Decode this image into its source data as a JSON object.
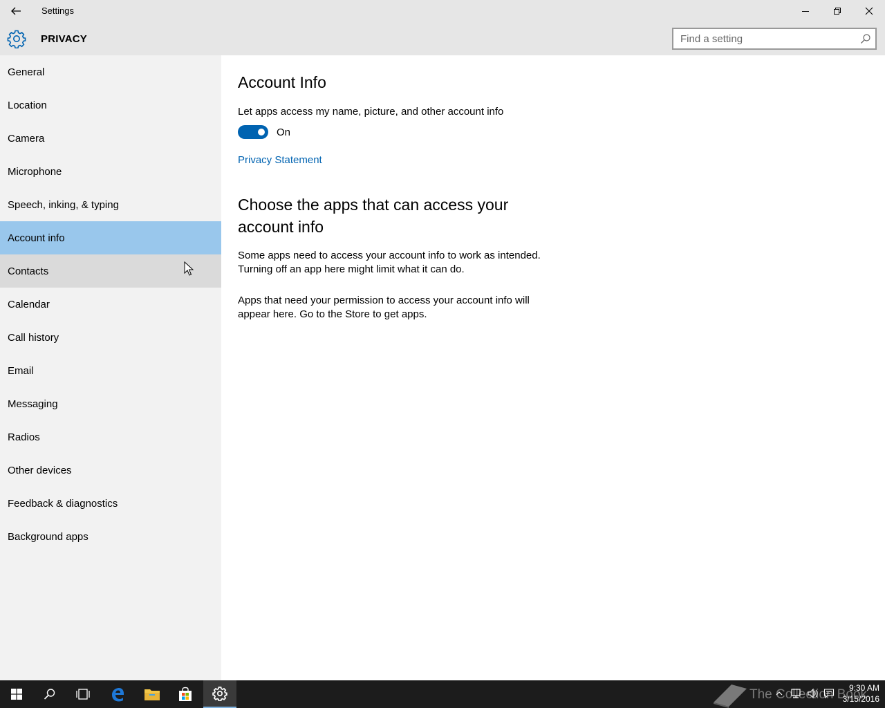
{
  "window": {
    "title": "Settings"
  },
  "header": {
    "title": "PRIVACY",
    "search_placeholder": "Find a setting"
  },
  "sidebar": {
    "items": [
      {
        "label": "General",
        "state": "normal"
      },
      {
        "label": "Location",
        "state": "normal"
      },
      {
        "label": "Camera",
        "state": "normal"
      },
      {
        "label": "Microphone",
        "state": "normal"
      },
      {
        "label": "Speech, inking, & typing",
        "state": "normal"
      },
      {
        "label": "Account info",
        "state": "selected"
      },
      {
        "label": "Contacts",
        "state": "hover"
      },
      {
        "label": "Calendar",
        "state": "normal"
      },
      {
        "label": "Call history",
        "state": "normal"
      },
      {
        "label": "Email",
        "state": "normal"
      },
      {
        "label": "Messaging",
        "state": "normal"
      },
      {
        "label": "Radios",
        "state": "normal"
      },
      {
        "label": "Other devices",
        "state": "normal"
      },
      {
        "label": "Feedback & diagnostics",
        "state": "normal"
      },
      {
        "label": "Background apps",
        "state": "normal"
      }
    ]
  },
  "main": {
    "heading": "Account Info",
    "toggle_label": "Let apps access my name, picture, and other account info",
    "toggle_on": true,
    "toggle_state_text": "On",
    "privacy_link": "Privacy Statement",
    "section_heading": "Choose the apps that can access your account info",
    "paragraph1": "Some apps need to access your account info to work as intended. Turning off an app here might limit what it can do.",
    "paragraph2": "Apps that need your permission to access your account info will appear here. Go to the Store to get apps."
  },
  "taskbar": {
    "watermark_text": "The Collection Book",
    "time": "9:30 AM",
    "date": "3/15/2016"
  },
  "colors": {
    "accent": "#0063b1",
    "selected_bg": "#99c7ec",
    "hover_bg": "#dadada",
    "sidebar_bg": "#f2f2f2",
    "header_bg": "#e6e6e6",
    "taskbar_bg": "#1c1c1c"
  }
}
